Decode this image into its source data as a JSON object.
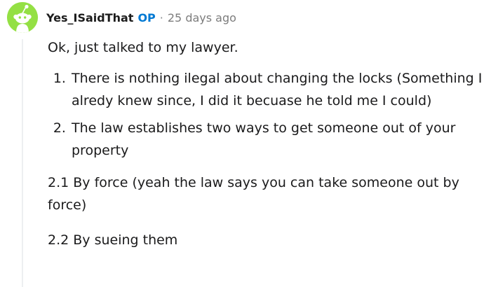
{
  "comment": {
    "author": "Yes_ISaidThat",
    "op_badge": "OP",
    "separator": "·",
    "timestamp": "25 days ago",
    "avatar_icon": "snoo-avatar-icon",
    "colors": {
      "avatar_bg": "#94e044",
      "op_badge": "#0079d3",
      "timestamp": "#7c7c7c",
      "thread_line": "#edeff1"
    },
    "body": {
      "intro": "Ok, just talked to my lawyer.",
      "list_items": [
        "There is nothing ilegal about changing the locks (Something I alredy knew since, I did it becuase he told me I could)",
        "The law establishes two ways to get someone out of your property"
      ],
      "sub_point_1": "2.1 By force (yeah the law says you can take someone out by force)",
      "sub_point_2": "2.2 By sueing them"
    }
  }
}
